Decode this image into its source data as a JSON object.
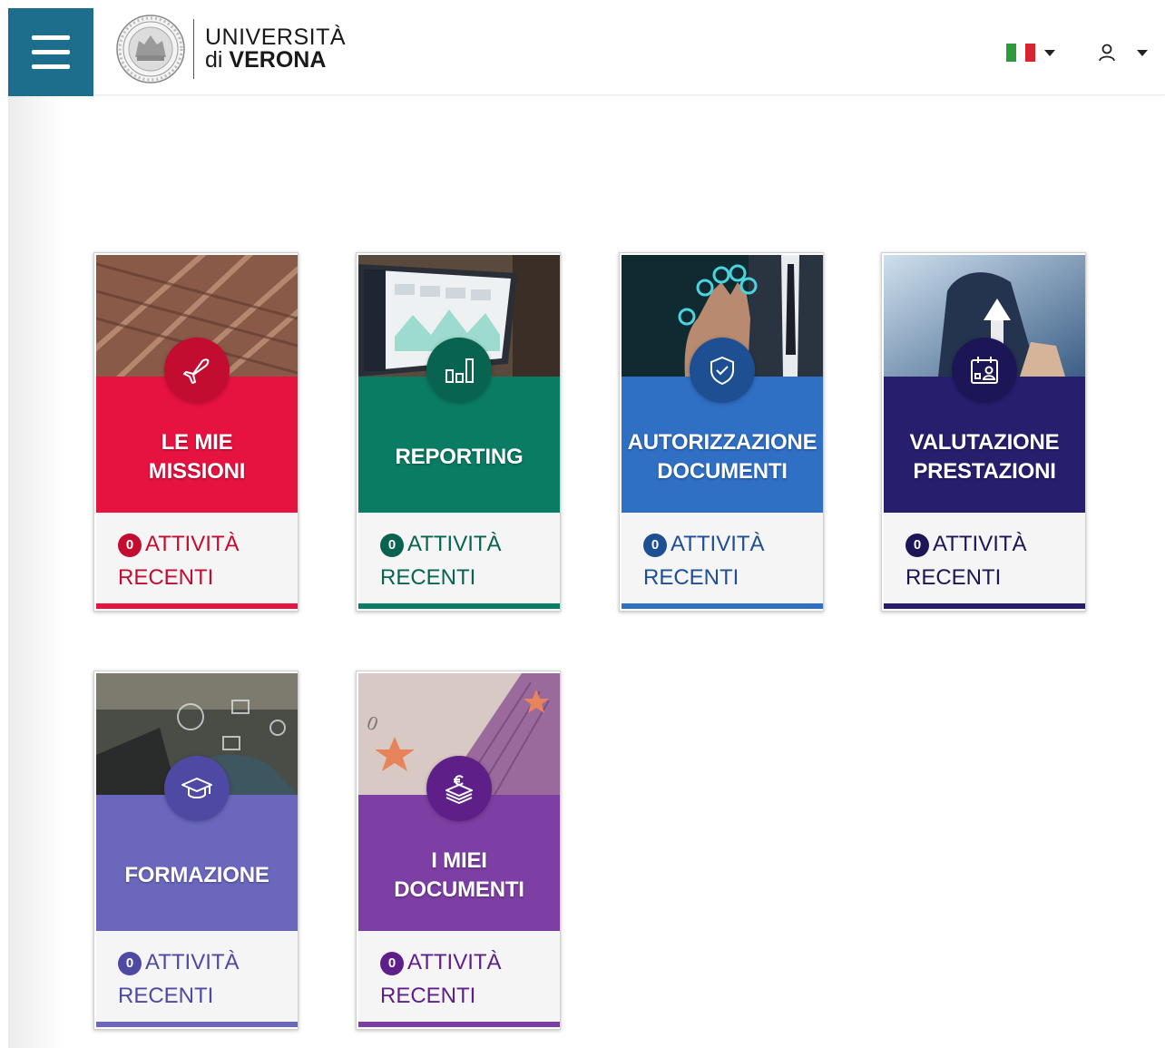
{
  "header": {
    "logo": {
      "line1": "UNIVERSITÀ",
      "line2_prefix": "di",
      "line2_bold": "VERONA"
    },
    "menu_icon": "hamburger-icon",
    "language_flag": "italy-flag-icon",
    "user_icon": "user-icon"
  },
  "colors": {
    "menu": "#1c6e8c",
    "missioni": "#e6123f",
    "reporting": "#0a7c64",
    "autorizzazione": "#2f6fc4",
    "valutazione": "#271e6e",
    "formazione": "#6a67bd",
    "documenti": "#7d3fa3"
  },
  "cards": [
    {
      "title_1": "LE MIE",
      "title_2": "MISSIONI",
      "count": "0",
      "activity_1": "ATTIVITÀ",
      "activity_2": "RECENTI",
      "icon": "airplane-icon"
    },
    {
      "title_1": "REPORTING",
      "title_2": "",
      "count": "0",
      "activity_1": "ATTIVITÀ",
      "activity_2": "RECENTI",
      "icon": "bar-chart-icon"
    },
    {
      "title_1": "AUTORIZZAZIONE",
      "title_2": "DOCUMENTI",
      "count": "0",
      "activity_1": "ATTIVITÀ",
      "activity_2": "RECENTI",
      "icon": "shield-check-icon"
    },
    {
      "title_1": "VALUTAZIONE",
      "title_2": "PRESTAZIONI",
      "count": "0",
      "activity_1": "ATTIVITÀ",
      "activity_2": "RECENTI",
      "icon": "calendar-user-icon"
    },
    {
      "title_1": "FORMAZIONE",
      "title_2": "",
      "count": "0",
      "activity_1": "ATTIVITÀ",
      "activity_2": "RECENTI",
      "icon": "graduation-cap-icon"
    },
    {
      "title_1": "I MIEI",
      "title_2": "DOCUMENTI",
      "count": "0",
      "activity_1": "ATTIVITÀ",
      "activity_2": "RECENTI",
      "icon": "euro-stack-icon"
    }
  ]
}
